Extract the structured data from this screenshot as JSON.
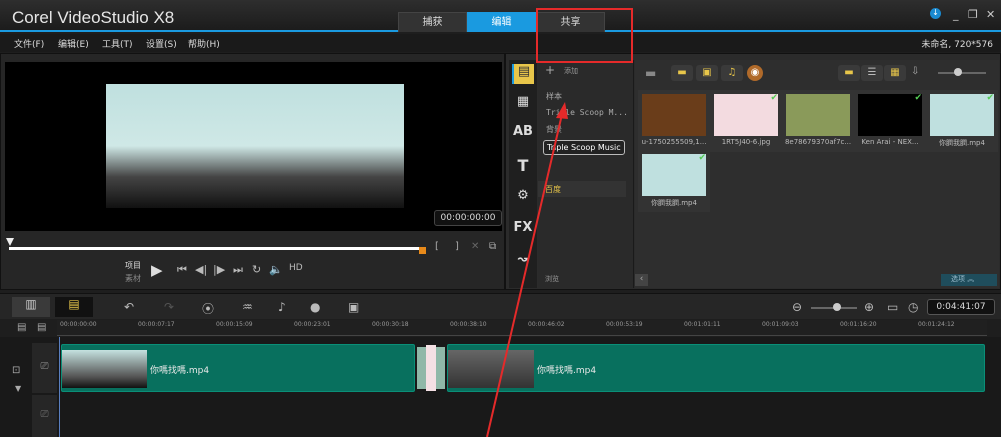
{
  "app": {
    "title": "Corel VideoStudio X8",
    "project_info": "未命名, 720*576"
  },
  "tabs": [
    {
      "label": "捕获"
    },
    {
      "label": "编辑",
      "active": true
    },
    {
      "label": "共享"
    }
  ],
  "menu": [
    "文件(F)",
    "编辑(E)",
    "工具(T)",
    "设置(S)",
    "帮助(H)"
  ],
  "player": {
    "mode_project": "项目",
    "mode_clip": "素材",
    "hd": "HD",
    "timecode": "00:00:00:00",
    "mark_in": "[",
    "mark_out": "]"
  },
  "library": {
    "add_label": "添加",
    "browse_label": "浏览",
    "options_label": "选项",
    "folders": [
      "样本",
      "Triple Scoop M...",
      "背景",
      "百度"
    ],
    "tooltip": "Triple Scoop Music",
    "items": [
      {
        "name": "u-1750255509,1...",
        "checked": false,
        "color": "#6a3d1a"
      },
      {
        "name": "1RT5J40-6.jpg",
        "checked": true,
        "color": "#f3dbe0"
      },
      {
        "name": "8e78679370af7c...",
        "checked": false,
        "color": "#8a9a5a"
      },
      {
        "name": "Ken Arai - NEX...",
        "checked": true,
        "color": "#000000"
      },
      {
        "name": "你膶我膶.mp4",
        "checked": true,
        "color": "#bfe0df"
      },
      {
        "name": "你膶我膶.mp4",
        "checked": true,
        "color": "#bfe0df"
      }
    ]
  },
  "timeline": {
    "timecode": "0:04:41:07",
    "ruler": [
      "00:00:00:00",
      "00:00:07:17",
      "00:00:15:09",
      "00:00:23:01",
      "00:00:30:18",
      "00:00:38:10",
      "00:00:46:02",
      "00:00:53:19",
      "00:01:01:11",
      "00:01:09:03",
      "00:01:16:20",
      "00:01:24:12"
    ],
    "clips": [
      {
        "name": "你嗎找嗎.mp4"
      },
      {
        "name": "你嗎找嗎.mp4"
      }
    ]
  },
  "colors": {
    "accent": "#1a9ae0",
    "clip": "#08705e",
    "annotation": "#e52a2a"
  }
}
